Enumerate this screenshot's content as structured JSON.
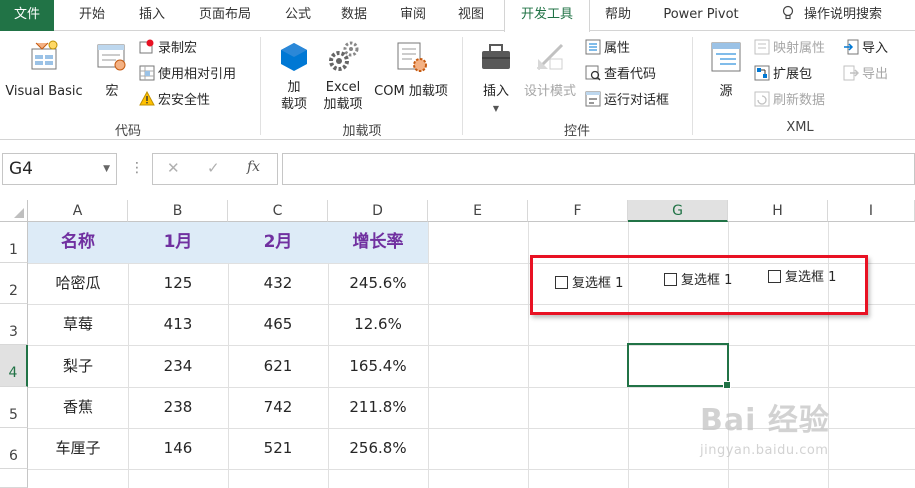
{
  "tabs": [
    "文件",
    "开始",
    "插入",
    "页面布局",
    "公式",
    "数据",
    "审阅",
    "视图",
    "开发工具",
    "帮助",
    "Power Pivot",
    "操作说明搜索"
  ],
  "active_tab": "开发工具",
  "ribbon": {
    "code": {
      "label": "代码",
      "visual_basic": "Visual Basic",
      "macros": "宏",
      "record_macro": "录制宏",
      "use_relative": "使用相对引用",
      "macro_security": "宏安全性"
    },
    "addins": {
      "label": "加载项",
      "addins_btn": "加\n载项",
      "excel_addins": "Excel\n加载项",
      "com_addins": "COM 加载项"
    },
    "controls": {
      "label": "控件",
      "insert": "插入",
      "design_mode": "设计模式",
      "properties": "属性",
      "view_code": "查看代码",
      "run_dialog": "运行对话框"
    },
    "xml": {
      "label": "XML",
      "source": "源",
      "map_properties": "映射属性",
      "expansion_packs": "扩展包",
      "refresh_data": "刷新数据",
      "import": "导入",
      "export": "导出"
    }
  },
  "formula_bar": {
    "name_box": "G4",
    "fx": "fx",
    "cancel": "✕",
    "enter": "✓",
    "formula": ""
  },
  "columns": [
    "A",
    "B",
    "C",
    "D",
    "E",
    "F",
    "G",
    "H",
    "I"
  ],
  "rows": [
    "1",
    "2",
    "3",
    "4",
    "5",
    "6"
  ],
  "table": {
    "headers": [
      "名称",
      "1月",
      "2月",
      "增长率"
    ],
    "rows": [
      [
        "哈密瓜",
        "125",
        "432",
        "245.6%"
      ],
      [
        "草莓",
        "413",
        "465",
        "12.6%"
      ],
      [
        "梨子",
        "234",
        "621",
        "165.4%"
      ],
      [
        "香蕉",
        "238",
        "742",
        "211.8%"
      ],
      [
        "车厘子",
        "146",
        "521",
        "256.8%"
      ]
    ]
  },
  "checkboxes": [
    "复选框 1",
    "复选框 1",
    "复选框 1"
  ],
  "watermark": {
    "main": "Bai 经验",
    "sub": "jingyan.baidu.com"
  },
  "colors": {
    "excel_green": "#217346",
    "header_fill": "#ddebf7",
    "header_text": "#7030a0",
    "highlight_red": "#e81123"
  }
}
